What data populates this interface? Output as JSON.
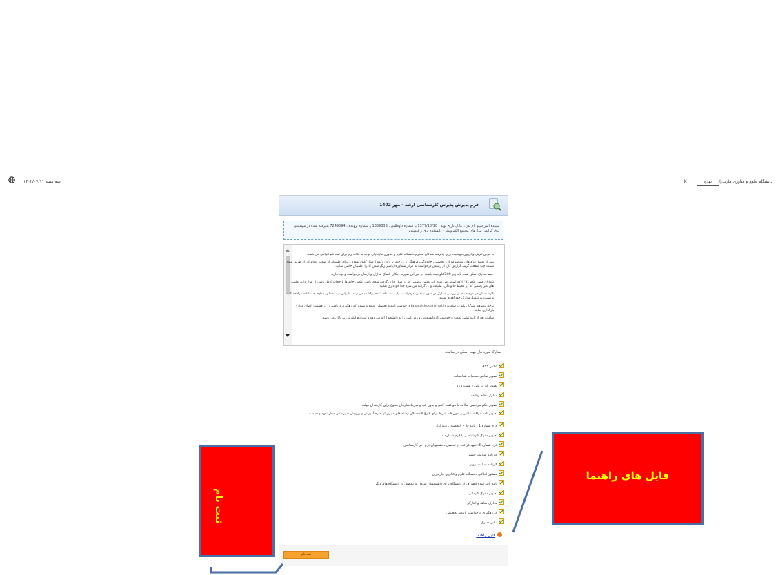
{
  "topbar": {
    "university": "دانشگاه علوم و فناوری مازندران",
    "user": "بهاره",
    "close": "x",
    "day": "سه شنبه",
    "date": "۱۴۰۲/۰۷/۱۱",
    "globe_icon": "globe-icon"
  },
  "panel": {
    "title": "فرم پذیرش پذیرش کارشناسی ارشد - مهر 1402",
    "icon": "document-search-icon"
  },
  "info": {
    "text": "سپیده امیرخلیلو نام پدر : عادل تاریخ تولد : 1377/10/10 با شماره داوطلبی : 1339833 و شماره پرونده : 7249594 پذیرفته شده در مهندسی برق گرایش مدارهای مجتمع الکترونیک - دانشکده برق و کامپیوتر"
  },
  "scroll": {
    "paragraphs": [
      "با عرض تبریک و آرزوی موفقیت برای پذیرفته شدگان محترم دانشگاه علوم و فناوری مازندران توجه به نکات زیر برای ثبت نام الزامی می باشد.",
      "پس از تکمیل فرم های شناسنامه ای، تحصیلی، خانوادگی، فرهنگی و ... حتما بر روی دکمه ارسال کلیک نموده و برای اطمینان از صحت انجام کار از طریق منوی سمت چپ صفحه، گزینه گزارش کار، از رسیدن درخواست به مرکز مشاوره (باسبز رنگ شدن کادر) اطمینان حاصل نمایید.",
      "حجم مدارک اسکن شده باید زیر 200کیلو بایت باشد، در غیر این صورت امکان الصاق مدارک و ارسال درخواست وجود ندارد.",
      "نکته ای مهم: عکس 3*4 که اسکن می شود باید عکس پرسنلی که در سال جاری گرفته شده، باشد. عکس خانم ها با حجاب کامل باشد. از قرار دادن عکس های غیر رسمی که در محیط خانوادگی، طبیعت و ... گرفته می شود جدا خودداری نمایید.",
      "کارشناسان هر مرحله بعد از بررسی مدارک در صورت نقص، درخواست را به ثبت نام کننده برگشت می زنند. بنابراین باید به طور مداوم به سامانه مراجعه کنید و نسبت به تکمیل مدارک خود اقدام نمایید.",
      "توجه: پذیرفته شدگان باید در سامانه https://sisudan.msrt.ir درخواست تاییدیه تحصیلی بدهند و تصویر کد رهگیری دریافتی را در قسمت الصاق مدارک بارگذاری نمایند.",
      "سامانه بعد از تایید نهایی تمدت درخواست کد دانشجویی و رمز عبور را به دانشجو ارائه می دهد و ثبت نام اینترنتی به پایان می رسد."
    ]
  },
  "docs": {
    "title": "مدارک مورد نیاز جهت اسکن در سامانه :",
    "items": [
      "عکس 3*4",
      "تصویر تمامی صفحات شناسنامه",
      "تصویر کارت ملی ( پشت و رو )",
      "مدارک نظام وظیفه",
      "تصویر حکم مرخصی ساالنه با موافقت کتبی و بدون قید و شرط سازمان متبوع برای کارمندان دولت",
      "تصویر نامه موافقت کتبی و بدون قید شرط برای فارغ التحصیلان رشته های دبیری از اداره آموزش و پرورش شهرستان محل تعهد و خدمت",
      "فرم شماره 1 : تایید فارغ التحصیلان رتبه اول",
      "تصویر مدرک کارشناسی یا فرم شماره 2",
      "فرم شماره 3: تعهد فراغت از تحصیل دانشجویان ترم آخر کارشناسی",
      "کارنامه سلامت جسم",
      "کارنامه سلامت روان",
      "منشور اخلاقی دانشگاه علوم و فناوری مازندران",
      "نامه تایید شده انصراف از دانشگاه برای دانشجویان شاغل به تحصیل در دانشگاه های دیگر",
      "تصویر مدرک کاردانی",
      "مدارک شاهد و ایثارگر",
      "کد رهگیری درخواست تاییدیه تحصیلی",
      "سایر مدارک"
    ]
  },
  "guide_link": "فایل راهنما",
  "register_button": "ثبت نام",
  "callouts": {
    "guide_files": "فایل های راهنما",
    "registration": "ثبت نام"
  },
  "colors": {
    "callout_bg": "#ff0000",
    "callout_text": "#ffff00",
    "callout_border": "#4a6fa5",
    "button": "#f7a12e"
  }
}
